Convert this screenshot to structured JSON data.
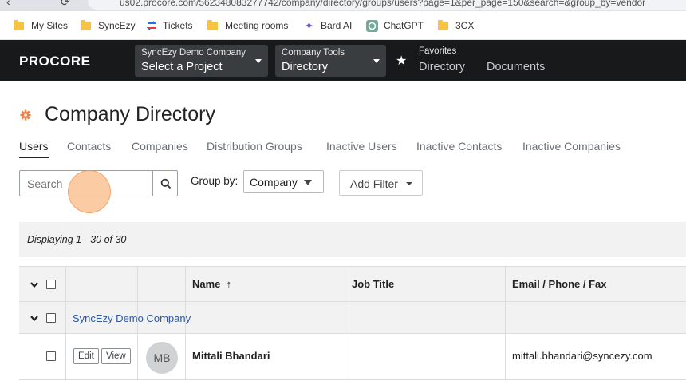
{
  "browser": {
    "url_partial": "us02.procore.com/562348083277742/company/directory/groups/users?page=1&per_page=150&search=&group_by=vendor"
  },
  "bookmarks": [
    {
      "label": "My Sites",
      "icon": "folder-icon"
    },
    {
      "label": "SyncEzy",
      "icon": "folder-icon"
    },
    {
      "label": "Tickets",
      "icon": "sync-icon"
    },
    {
      "label": "Meeting rooms",
      "icon": "folder-icon"
    },
    {
      "label": "Bard AI",
      "icon": "sparkle-icon"
    },
    {
      "label": "ChatGPT",
      "icon": "chatgpt-icon"
    },
    {
      "label": "3CX",
      "icon": "folder-icon"
    }
  ],
  "topbar": {
    "logo": "PROCORE",
    "project_picker": {
      "small": "SyncEzy Demo Company",
      "big": "Select a Project"
    },
    "tool_picker": {
      "small": "Company Tools",
      "big": "Directory"
    },
    "favorites_label": "Favorites",
    "favorite_links": [
      "Directory",
      "Documents"
    ]
  },
  "page": {
    "title": "Company Directory",
    "tabs": [
      "Users",
      "Contacts",
      "Companies",
      "Distribution Groups",
      "Inactive Users",
      "Inactive Contacts",
      "Inactive Companies"
    ],
    "active_tab": "Users"
  },
  "controls": {
    "search_placeholder": "Search",
    "group_by_label": "Group by:",
    "group_by_value": "Company",
    "add_filter_label": "Add Filter"
  },
  "display_text": "Displaying 1 - 30 of 30",
  "table": {
    "columns": [
      "Name",
      "Job Title",
      "Email / Phone / Fax"
    ],
    "sort_indicator": "↑",
    "group_name": "SyncEzy Demo Company",
    "rows": [
      {
        "edit_label": "Edit",
        "view_label": "View",
        "initials": "MB",
        "name": "Mittali Bhandari",
        "job_title": "",
        "email": "mittali.bhandari@syncezy.com"
      }
    ]
  },
  "colors": {
    "topbar_bg": "#18191a",
    "accent_orange": "#f47e42",
    "link_blue": "#2c5aa0",
    "table_header_bg": "#f2f2f2"
  }
}
